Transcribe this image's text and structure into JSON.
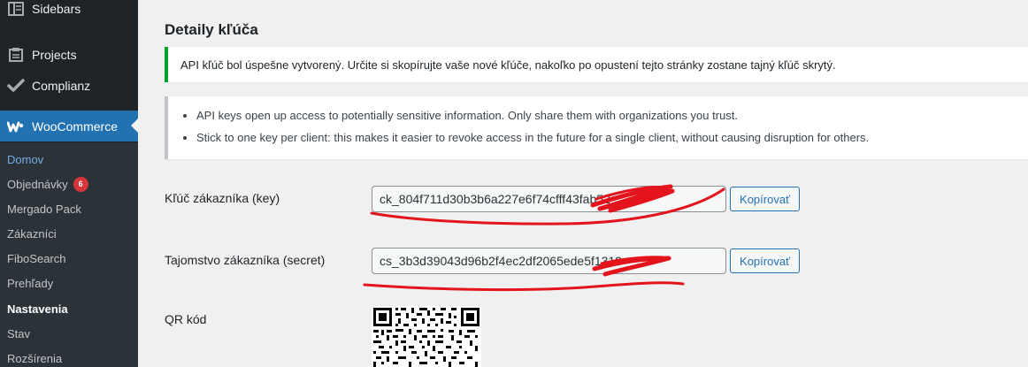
{
  "sidebar": {
    "menu": [
      {
        "label": "Sidebars",
        "icon": "sidebars-icon"
      },
      {
        "label": "Projects",
        "icon": "projects-icon"
      },
      {
        "label": "Complianz",
        "icon": "checkmark-icon"
      },
      {
        "label": "WooCommerce",
        "icon": "woocommerce-icon"
      }
    ],
    "submenu": [
      {
        "label": "Domov"
      },
      {
        "label": "Objednávky",
        "badge": "6"
      },
      {
        "label": "Mergado Pack"
      },
      {
        "label": "Zákazníci"
      },
      {
        "label": "FiboSearch"
      },
      {
        "label": "Prehľady"
      },
      {
        "label": "Nastavenia"
      },
      {
        "label": "Stav"
      },
      {
        "label": "Rozšírenia"
      }
    ]
  },
  "main": {
    "title": "Detaily kľúča",
    "success_notice": "API kľúč bol úspešne vytvorený. Určite si skopírujte vaše nové kľúče, nakoľko po opustení tejto stránky zostane tajný kľúč skrytý.",
    "info_notice": [
      "API keys open up access to potentially sensitive information. Only share them with organizations you trust.",
      "Stick to one key per client: this makes it easier to revoke access in the future for a single client, without causing disruption for others."
    ],
    "consumer_key": {
      "label": "Kľúč zákazníka (key)",
      "value": "ck_804f711d30b3b6a227e6f74cfff43fab52"
    },
    "consumer_secret": {
      "label": "Tajomstvo zákazníka (secret)",
      "value": "cs_3b3d39043d96b2f4ec2df2065ede5f1319"
    },
    "copy_button": "Kopírovať",
    "qr_label": "QR kód"
  },
  "colors": {
    "sidebar_bg": "#1d2327",
    "submenu_bg": "#2c3338",
    "active_menu": "#2271b1",
    "badge": "#d63638",
    "success_border": "#00a32a",
    "scribble": "#e3141b"
  }
}
